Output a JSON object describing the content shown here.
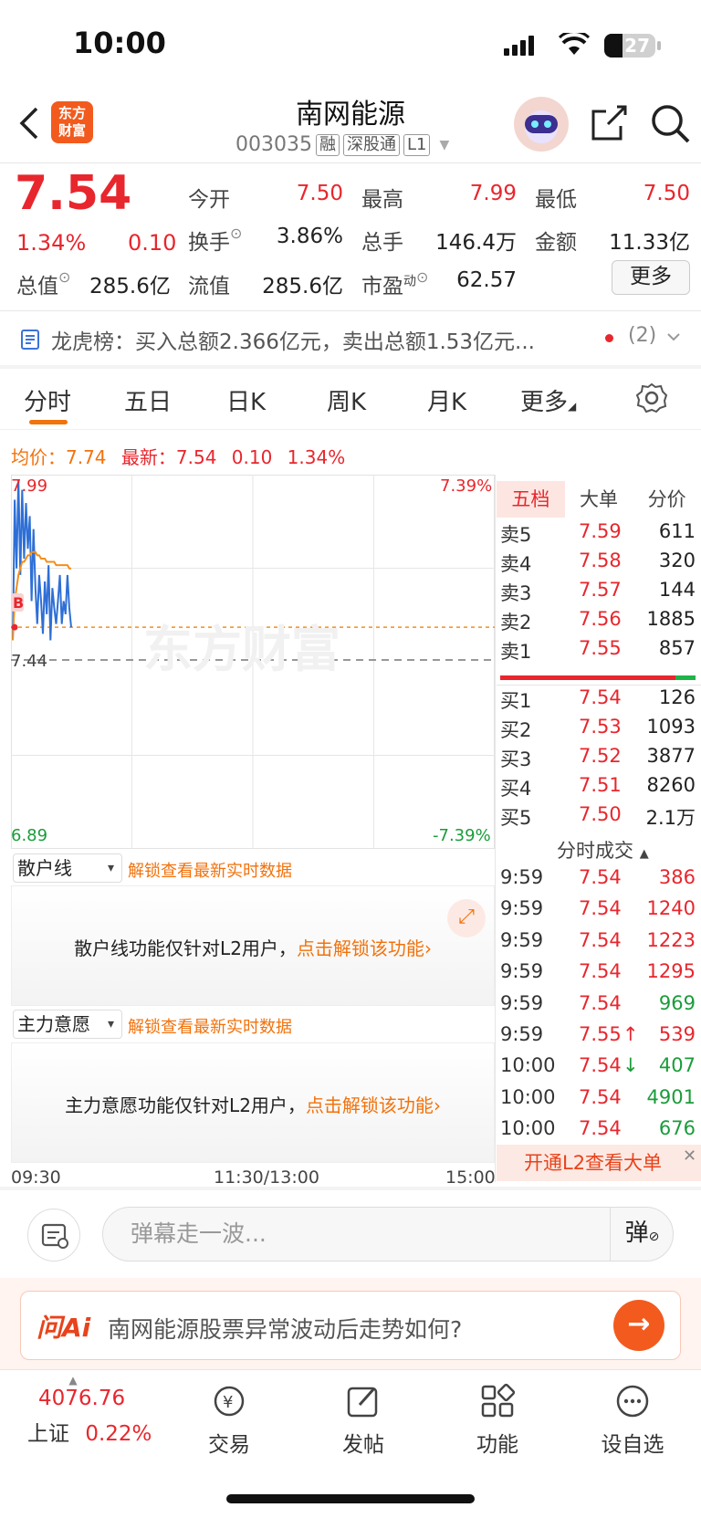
{
  "status_bar": {
    "time": "10:00",
    "battery": "27"
  },
  "header": {
    "logo": "东方\n财富",
    "title": "南网能源",
    "code": "003035",
    "tags": [
      "融",
      "深股通",
      "L1"
    ]
  },
  "quote": {
    "price": "7.54",
    "change_pct": "1.34%",
    "change": "0.10",
    "row1": [
      {
        "label": "今开",
        "value": "7.50"
      },
      {
        "label": "最高",
        "value": "7.99"
      },
      {
        "label": "最低",
        "value": "7.50"
      }
    ],
    "row2": [
      {
        "label": "换手",
        "value": "3.86%"
      },
      {
        "label": "总手",
        "value": "146.4万"
      },
      {
        "label": "金额",
        "value": "11.33亿"
      }
    ],
    "row3": [
      {
        "label": "总值",
        "value": "285.6亿"
      },
      {
        "label": "流值",
        "value": "285.6亿"
      },
      {
        "label": "市盈",
        "sup": "动",
        "value": "62.57"
      }
    ],
    "more": "更多"
  },
  "dragon": {
    "label": "龙虎榜：",
    "text": "买入总额2.366亿元，卖出总额1.53亿元...",
    "count": "(2)"
  },
  "tabs": [
    "分时",
    "五日",
    "日K",
    "周K",
    "月K",
    "更多"
  ],
  "stats": {
    "avg_label": "均价：",
    "avg": "7.74",
    "latest_label": "最新：",
    "latest": "7.54",
    "chg": "0.10",
    "pct": "1.34%"
  },
  "chart_data": {
    "type": "line",
    "y_top": "7.99",
    "y_mid": "7.44",
    "y_bottom": "6.89",
    "pct_top": "7.39%",
    "pct_bottom": "-7.39%",
    "ylim": [
      6.89,
      7.99
    ],
    "prev_close": 7.44,
    "current": 7.54,
    "x_ticks": [
      "09:30",
      "11:30/13:00",
      "15:00"
    ],
    "series": [
      {
        "color": "#2e6fd6",
        "values": [
          7.5,
          7.93,
          7.72,
          7.99,
          7.7,
          7.96,
          7.75,
          7.92,
          7.78,
          7.88,
          7.62,
          7.84,
          7.66,
          7.55,
          7.7,
          7.62,
          7.52,
          7.68,
          7.58,
          7.73,
          7.5,
          7.66,
          7.6,
          7.55,
          7.62,
          7.7,
          7.55,
          7.62,
          7.58,
          7.7,
          7.6,
          7.54
        ]
      },
      {
        "color": "#f28f1c",
        "values": [
          7.5,
          7.62,
          7.66,
          7.7,
          7.72,
          7.74,
          7.74,
          7.75,
          7.76,
          7.76,
          7.77,
          7.77,
          7.77,
          7.76,
          7.76,
          7.75,
          7.75,
          7.75,
          7.74,
          7.74,
          7.74,
          7.74,
          7.74,
          7.73,
          7.73,
          7.73,
          7.73,
          7.73,
          7.73,
          7.73,
          7.72,
          7.72
        ]
      }
    ],
    "marker": "B"
  },
  "watermark": "东方财富",
  "orderbook": {
    "tabs": [
      "五档",
      "大单",
      "分价"
    ],
    "sell": [
      {
        "l": "卖5",
        "p": "7.59",
        "v": "611"
      },
      {
        "l": "卖4",
        "p": "7.58",
        "v": "320"
      },
      {
        "l": "卖3",
        "p": "7.57",
        "v": "144"
      },
      {
        "l": "卖2",
        "p": "7.56",
        "v": "1885"
      },
      {
        "l": "卖1",
        "p": "7.55",
        "v": "857"
      }
    ],
    "buy": [
      {
        "l": "买1",
        "p": "7.54",
        "v": "126"
      },
      {
        "l": "买2",
        "p": "7.53",
        "v": "1093"
      },
      {
        "l": "买3",
        "p": "7.52",
        "v": "3877"
      },
      {
        "l": "买4",
        "p": "7.51",
        "v": "8260"
      },
      {
        "l": "买5",
        "p": "7.50",
        "v": "2.1万"
      }
    ],
    "trades_title": "分时成交",
    "trades": [
      {
        "t": "9:59",
        "p": "7.54",
        "a": "",
        "v": "386",
        "c": "red"
      },
      {
        "t": "9:59",
        "p": "7.54",
        "a": "",
        "v": "1240",
        "c": "red"
      },
      {
        "t": "9:59",
        "p": "7.54",
        "a": "",
        "v": "1223",
        "c": "red"
      },
      {
        "t": "9:59",
        "p": "7.54",
        "a": "",
        "v": "1295",
        "c": "red"
      },
      {
        "t": "9:59",
        "p": "7.54",
        "a": "",
        "v": "969",
        "c": "green"
      },
      {
        "t": "9:59",
        "p": "7.55",
        "a": "↑",
        "v": "539",
        "c": "red"
      },
      {
        "t": "10:00",
        "p": "7.54",
        "a": "↓",
        "v": "407",
        "c": "green"
      },
      {
        "t": "10:00",
        "p": "7.54",
        "a": "",
        "v": "4901",
        "c": "green"
      },
      {
        "t": "10:00",
        "p": "7.54",
        "a": "",
        "v": "676",
        "c": "green"
      }
    ],
    "l2_banner": "开通L2查看大单"
  },
  "panels": [
    {
      "name": "散户线",
      "note": "解锁查看最新实时数据",
      "body": "散户线功能仅针对L2用户，",
      "link": "点击解锁该功能"
    },
    {
      "name": "主力意愿",
      "note": "解锁查看最新实时数据",
      "body": "主力意愿功能仅针对L2用户，",
      "link": "点击解锁该功能"
    }
  ],
  "comment": {
    "placeholder": "弹幕走一波...",
    "danmu": "弹"
  },
  "ai": {
    "logo": "问Ai",
    "question": "南网能源股票异常波动后走势如何?"
  },
  "nav": {
    "index_value": "4076.76",
    "index_name": "上证",
    "index_pct": "0.22%",
    "items": [
      "交易",
      "发帖",
      "功能",
      "设自选"
    ]
  }
}
